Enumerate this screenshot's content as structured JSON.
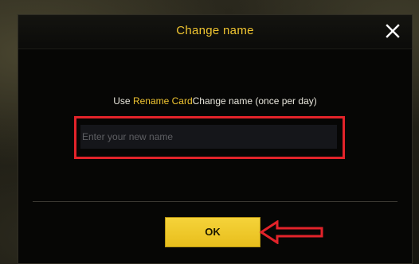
{
  "dialog": {
    "title": "Change name",
    "close_icon": "close-icon",
    "instruction_prefix": "Use ",
    "instruction_highlight": "Rename Card",
    "instruction_suffix": "Change name (once per day)",
    "input": {
      "value": "",
      "placeholder": "Enter your new name"
    },
    "ok_label": "OK"
  },
  "annotations": {
    "highlight_box_color": "#e2232a",
    "arrow_color": "#e2232a",
    "arrow_icon": "left-arrow-icon"
  },
  "colors": {
    "accent": "#f0c531",
    "dialog_bg": "#060605",
    "button_bg": "#f0c929"
  }
}
